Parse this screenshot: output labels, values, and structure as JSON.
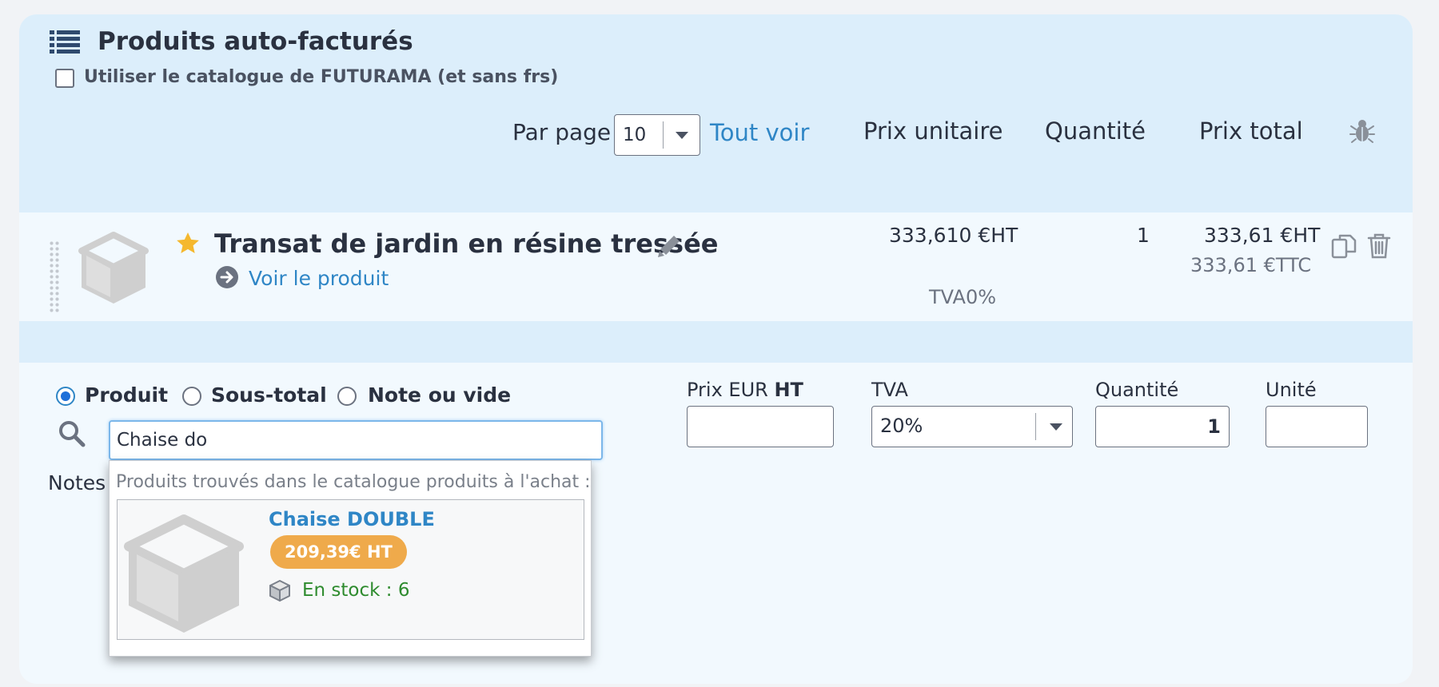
{
  "header": {
    "title": "Produits auto-facturés",
    "catalog_checkbox_label": "Utiliser le catalogue de FUTURAMA (et sans frs)",
    "catalog_checked": false,
    "per_page_label": "Par page",
    "per_page_value": "10",
    "see_all_label": "Tout voir",
    "col_unit_price": "Prix unitaire",
    "col_quantity": "Quantité",
    "col_total_price": "Prix total",
    "debug_icon": "bug-icon"
  },
  "line_item": {
    "name": "Transat de jardin en résine tressée",
    "favorite_icon": "star-icon",
    "view_link": "Voir le produit",
    "unit_price": "333,610 €HT",
    "vat": "TVA0%",
    "quantity": "1",
    "total_ht": "333,61 €HT",
    "total_ttc": "333,61 €TTC"
  },
  "new_line": {
    "types": [
      {
        "label": "Produit",
        "selected": true
      },
      {
        "label": "Sous-total",
        "selected": false
      },
      {
        "label": "Note ou vide",
        "selected": false
      }
    ],
    "search_value": "Chaise do",
    "notes_label": "Notes",
    "price_label": "Prix EUR",
    "price_label_bold": "HT",
    "price_value": "",
    "vat_label": "TVA",
    "vat_value": "20%",
    "qty_label": "Quantité",
    "qty_value": "1",
    "unit_label": "Unité",
    "unit_value": ""
  },
  "autocomplete": {
    "heading": "Produits trouvés dans le catalogue produits à l'achat :",
    "results": [
      {
        "name": "Chaise DOUBLE",
        "price": "209,39€ HT",
        "stock": "En stock : 6"
      }
    ]
  },
  "colors": {
    "accent": "#2f86c6",
    "header_band": "#dceefb",
    "row_bg": "#f2f9fe",
    "star": "#f5b82e",
    "price_badge": "#efaa4b",
    "stock_green": "#2e8b2e"
  }
}
